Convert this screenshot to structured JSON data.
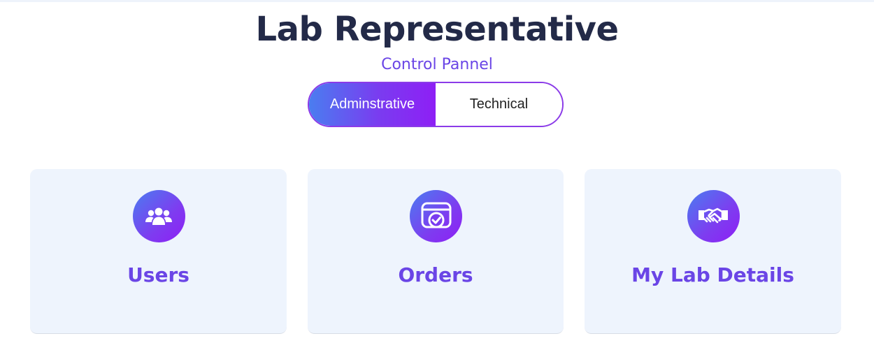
{
  "header": {
    "title": "Lab Representative",
    "subtitle": "Control Pannel"
  },
  "toggle": {
    "active_label": "Adminstrative",
    "inactive_label": "Technical"
  },
  "cards": [
    {
      "label": "Users",
      "icon": "users-icon"
    },
    {
      "label": "Orders",
      "icon": "orders-check-icon"
    },
    {
      "label": "My Lab Details",
      "icon": "handshake-icon"
    }
  ],
  "colors": {
    "title": "#232a48",
    "accent": "#6a45e6",
    "gradient_start": "#4a7df0",
    "gradient_end": "#8e1ff5",
    "card_bg": "#eef4fd"
  }
}
